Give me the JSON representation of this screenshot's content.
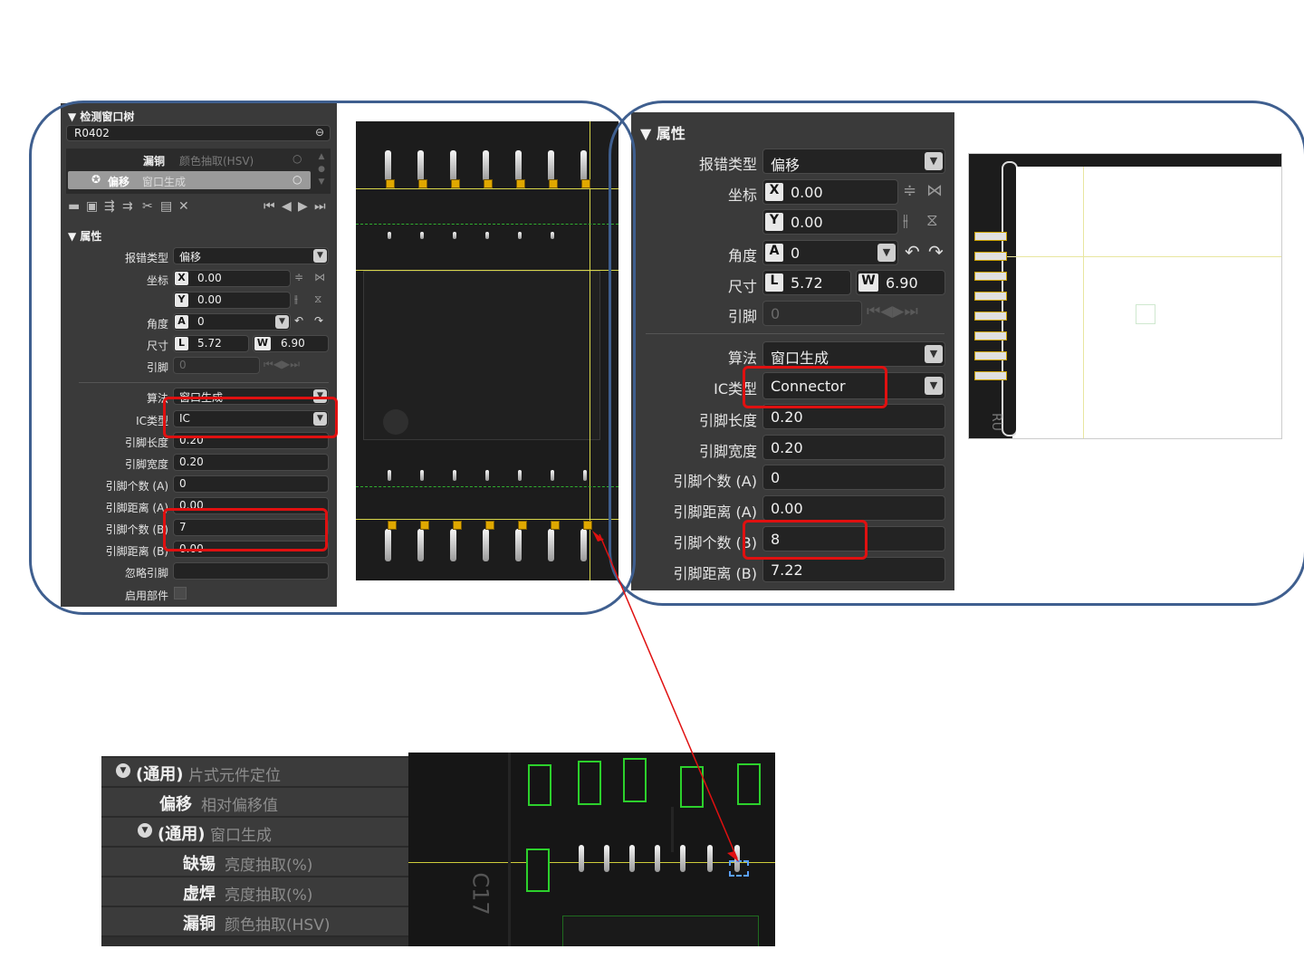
{
  "left_panel": {
    "tree_title": "检测窗口树",
    "search_value": "R0402",
    "tree_items": [
      {
        "name": "漏铜",
        "method": "颜色抽取(HSV)"
      },
      {
        "name": "偏移",
        "method": "窗口生成"
      }
    ],
    "props_header": "属性",
    "labels": {
      "error_type": "报错类型",
      "coord": "坐标",
      "angle": "角度",
      "size": "尺寸",
      "pin": "引脚",
      "algo": "算法",
      "ic_type": "IC类型",
      "pin_len": "引脚长度",
      "pin_width": "引脚宽度",
      "pin_count_a": "引脚个数 (A)",
      "pin_dist_a": "引脚距离 (A)",
      "pin_count_b": "引脚个数 (B)",
      "pin_dist_b": "引脚距离 (B)",
      "ignore_pin": "忽略引脚",
      "enable_part": "启用部件"
    },
    "values": {
      "error_type": "偏移",
      "x": "0.00",
      "y": "0.00",
      "angle": "0",
      "l": "5.72",
      "w": "6.90",
      "pin": "0",
      "algo": "窗口生成",
      "ic_type": "IC",
      "pin_len": "0.20",
      "pin_width": "0.20",
      "pin_count_a": "0",
      "pin_dist_a": "0.00",
      "pin_count_b": "7",
      "pin_dist_b": "0.00"
    },
    "tags": {
      "x": "X",
      "y": "Y",
      "a": "A",
      "l": "L",
      "w": "W"
    }
  },
  "right_panel": {
    "props_header": "属性",
    "labels": {
      "error_type": "报错类型",
      "coord": "坐标",
      "angle": "角度",
      "size": "尺寸",
      "pin": "引脚",
      "algo": "算法",
      "ic_type": "IC类型",
      "pin_len": "引脚长度",
      "pin_width": "引脚宽度",
      "pin_count_a": "引脚个数 (A)",
      "pin_dist_a": "引脚距离 (A)",
      "pin_count_b": "引脚个数 (B)",
      "pin_dist_b": "引脚距离 (B)"
    },
    "values": {
      "error_type": "偏移",
      "x": "0.00",
      "y": "0.00",
      "angle": "0",
      "l": "5.72",
      "w": "6.90",
      "pin": "0",
      "algo": "窗口生成",
      "ic_type": "Connector",
      "pin_len": "0.20",
      "pin_width": "0.20",
      "pin_count_a": "0",
      "pin_dist_a": "0.00",
      "pin_count_b": "8",
      "pin_dist_b": "7.22"
    },
    "tags": {
      "x": "X",
      "y": "Y",
      "a": "A",
      "l": "L",
      "w": "W"
    }
  },
  "bottom_tree": [
    {
      "name": "(通用)",
      "method": "片式元件定位"
    },
    {
      "name": "偏移",
      "method": "相对偏移值"
    },
    {
      "name": "(通用)",
      "method": "窗口生成"
    },
    {
      "name": "缺锡",
      "method": "亮度抽取(%)"
    },
    {
      "name": "虚焊",
      "method": "亮度抽取(%)"
    },
    {
      "name": "漏铜",
      "method": "颜色抽取(HSV)"
    }
  ],
  "pcb_text": {
    "silk_1": "RU",
    "silk_2": "C17"
  },
  "colors": {
    "highlight_red": "#e01010",
    "outline_blue": "#3f5f8f",
    "arrow_red": "#e01010"
  }
}
